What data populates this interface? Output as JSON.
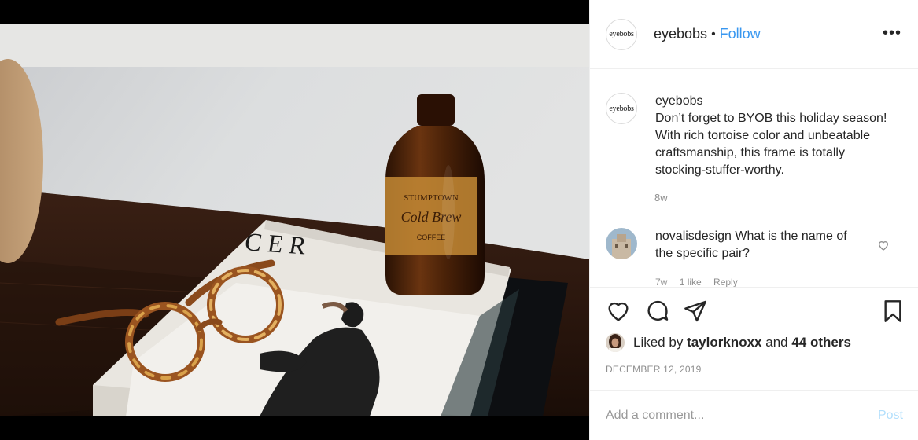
{
  "header": {
    "avatar_text": "eyebobs",
    "username": "eyebobs",
    "separator": "•",
    "follow_label": "Follow",
    "more_label": "•••"
  },
  "caption": {
    "avatar_text": "eyebobs",
    "username": "eyebobs",
    "text": "Don’t forget to BYOB this holiday season! With rich tortoise color and unbeatable craftsmanship, this frame is totally stocking-stuffer-worthy.",
    "time": "8w"
  },
  "comment": {
    "username": "novalisdesign",
    "text": "What is the name of the specific pair?",
    "time": "7w",
    "likes": "1 like",
    "reply_label": "Reply"
  },
  "likes": {
    "prefix": "Liked by ",
    "user": "taylorknoxx",
    "middle": " and ",
    "others": "44 others"
  },
  "date": "DECEMBER 12, 2019",
  "add_comment": {
    "placeholder": "Add a comment...",
    "post_label": "Post"
  },
  "photo": {
    "magazine_title": "C E R",
    "label_line1": "STUMPTOWN",
    "label_line2": "Cold Brew",
    "label_line3": "COFFEE"
  },
  "icons": [
    "heart-icon",
    "comment-icon",
    "share-icon",
    "bookmark-icon",
    "more-icon"
  ],
  "colors": {
    "accent": "#3897f0",
    "post_disabled": "#b2dffc",
    "muted": "#8e8e8e",
    "text": "#262626"
  }
}
